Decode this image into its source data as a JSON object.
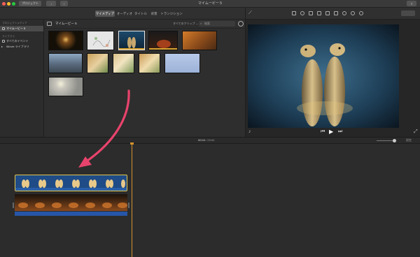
{
  "titlebar": {
    "projects_button": "プロジェクト",
    "title": "マイムービー 5"
  },
  "tabs": [
    {
      "label": "マイメディア",
      "active": true
    },
    {
      "label": "オーディオ",
      "active": false
    },
    {
      "label": "タイトル",
      "active": false
    },
    {
      "label": "背景",
      "active": false
    },
    {
      "label": "トランジション",
      "active": false
    }
  ],
  "sidebar": {
    "project_media_header": "プロジェクトメディア",
    "project_item": "マイムービー 5",
    "libraries_header": "ライブラリ",
    "all_events": "すべてのイベント",
    "imovie_library": "iMovie ライブラリ"
  },
  "browser": {
    "title": "マイムービー 5",
    "filter": "すべてのクリップ",
    "search_placeholder": "検索"
  },
  "timeline": {
    "current_time": "00:04",
    "separator": "/",
    "total_time": "00:54",
    "settings_label": "設定"
  },
  "colors": {
    "accent": "#d3922c",
    "arrow": "#e8436c",
    "selection": "#e6e6e6"
  }
}
